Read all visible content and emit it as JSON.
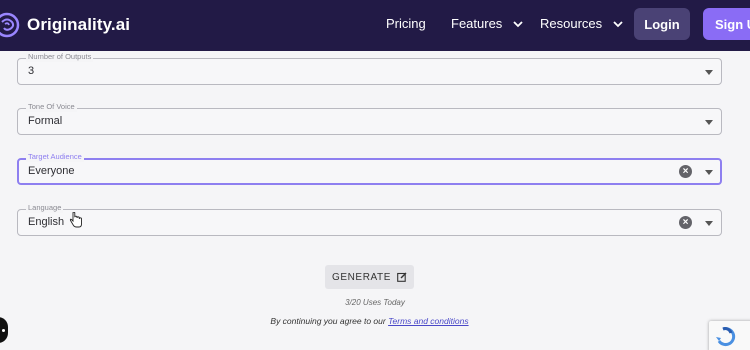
{
  "header": {
    "brand": "Originality.ai",
    "nav": [
      {
        "label": "Pricing",
        "has_caret": false
      },
      {
        "label": "Features",
        "has_caret": true
      },
      {
        "label": "Resources",
        "has_caret": true
      }
    ],
    "login_label": "Login",
    "signup_label": "Sign U"
  },
  "form": {
    "fields": [
      {
        "label": "Number of Outputs",
        "value": "3"
      },
      {
        "label": "Tone Of Voice",
        "value": "Formal"
      },
      {
        "label": "Target Audience",
        "value": "Everyone"
      },
      {
        "label": "Language",
        "value": "English"
      }
    ],
    "generate_label": "GENERATE",
    "uses_today": "3/20 Uses Today",
    "terms_prefix": "By continuing you agree to our",
    "terms_link": "Terms and conditions"
  },
  "colors": {
    "header_bg": "#221a46",
    "accent": "#8a6cf5",
    "focus_border": "#8e7ff0",
    "link": "#4a48c8"
  },
  "icons": {
    "logo": "brain-logo-icon",
    "dropdown": "chevron-down-icon",
    "clear": "clear-icon",
    "generate": "edit-icon",
    "cursor": "hand-cursor-icon"
  }
}
